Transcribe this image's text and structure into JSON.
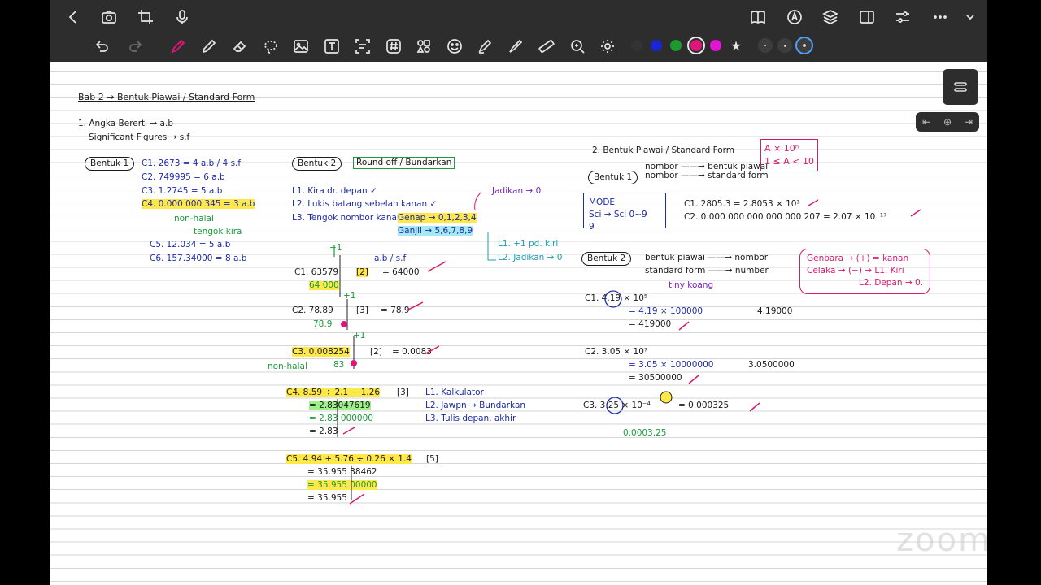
{
  "toolbar": {
    "top_icons_left": [
      "back-icon",
      "camera-icon",
      "crop-icon",
      "microphone-icon"
    ],
    "top_icons_right": [
      "book-icon",
      "pen-circle-icon",
      "layers-icon",
      "sidebar-icon",
      "sliders-icon",
      "more-icon",
      "chevron-down-icon"
    ],
    "tools": [
      "undo-icon",
      "redo-icon",
      "pen-icon",
      "pencil-icon",
      "eraser-icon",
      "lasso-icon",
      "image-icon",
      "text-icon",
      "scan-icon",
      "hashtag-icon",
      "shapes-icon",
      "sticker-icon",
      "highlighter-icon",
      "marker-icon",
      "ruler-icon",
      "zoom-icon",
      "gear-icon"
    ],
    "colors": [
      "#333333",
      "#1a25d6",
      "#1a9b2c",
      "#e0157a",
      "#e414d6"
    ],
    "selected_color": "#e0157a",
    "favorite_icon": "star-icon"
  },
  "watermark": "zoom",
  "note": {
    "title": "Bab 2 → Bentuk Piawai / Standard Form",
    "s1_heading": "1. Angka Bererti → a.b",
    "s1_sub": "Significant Figures → s.f",
    "bentuk1": "Bentuk 1",
    "b1_lines": [
      "C1. 2673 = 4 a.b / 4 s.f",
      "C2. 749995 = 6 a.b",
      "C3. 1.2745 = 5 a.b",
      "C4. 0.000 000 345 = 3 a.b",
      "non-halal",
      "tengok kira",
      "C5. 12.034 = 5 a.b",
      "C6. 157.34000 = 8 a.b"
    ],
    "bentuk2": "Bentuk 2",
    "round_off": "Round off / Bundarkan",
    "steps": [
      "L1. Kira dr. depan ✓",
      "L2. Lukis batang sebelah kanan ✓",
      "L3. Tengok nombor kanan"
    ],
    "jadikan_0": "Jadikan → 0",
    "genap": "Genap → 0,1,2,3,4",
    "ganjil": "Ganjil → 5,6,7,8,9",
    "side_steps": [
      "L1. +1 pd. kiri",
      "L2. Jadikan → 0"
    ],
    "ab_sf": "a.b / s.f",
    "c1": {
      "q": "C1. 63579",
      "sig": "[2]",
      "ans": "= 64000",
      "work": "64 000",
      "plus": "+1"
    },
    "c2": {
      "q": "C2. 78.89",
      "sig": "[3]",
      "ans": "= 78.9",
      "work": "78.9",
      "plus": "+1"
    },
    "c3": {
      "q": "C3. 0.008254",
      "sig": "[2]",
      "ans": "= 0.0083",
      "work": "83",
      "non": "non-halal",
      "plus": "+1"
    },
    "c4": {
      "q": "C4. 8.59 ÷ 2.1 − 1.26",
      "sig": "[3]",
      "l1": "= 2.83047619",
      "l2": "= 2.83 000000",
      "l3": "= 2.83",
      "steps": [
        "L1. Kalkulator",
        "L2. Jawpn → Bundarkan",
        "L3. Tulis depan. akhir"
      ]
    },
    "c5": {
      "q": "C5. 4.94 + 5.76 ÷ 0.26 × 1.4",
      "sig": "[5]",
      "l1": "= 35.955 38462",
      "l2": "= 35.955 00000",
      "l3": "= 35.955"
    },
    "s2_heading": "2. Bentuk Piawai / Standard Form",
    "formula": [
      "A × 10ⁿ",
      "1 ≤ A < 10"
    ],
    "sf_b1": "Bentuk 1",
    "sf_b1_lines": [
      "nombor ——→ bentuk piawai",
      "nombor ——→ standard form"
    ],
    "mode": [
      "MODE",
      "Sci → Sci 0~9",
      "9"
    ],
    "sf_ex": [
      "C1. 2805.3 = 2.8053 × 10³",
      "C2. 0.000 000 000 000 000 207 = 2.07 × 10⁻¹⁷"
    ],
    "sf_b2": "Bentuk 2",
    "sf_b2_lines": [
      "bentuk piawai ——→ nombor",
      "standard form ——→ number"
    ],
    "pink_box": [
      "Genbara → (+) = kanan",
      "Celaka → (−) → L1. Kiri",
      "L2. Depan → 0."
    ],
    "d1": {
      "q": "C1. 4.19 × 10⁵",
      "note": "tiny koang",
      "l1": "= 4.19 × 100000",
      "l2": "= 419000",
      "side": "4.19000"
    },
    "d2": {
      "q": "C2. 3.05 × 10⁷",
      "l1": "= 3.05 × 10000000",
      "l2": "= 30500000",
      "side": "3.0500000"
    },
    "d3": {
      "q": "C3. 3.25 × 10⁻⁴",
      "ans": "= 0.000325",
      "side": "0.0003.25"
    }
  }
}
